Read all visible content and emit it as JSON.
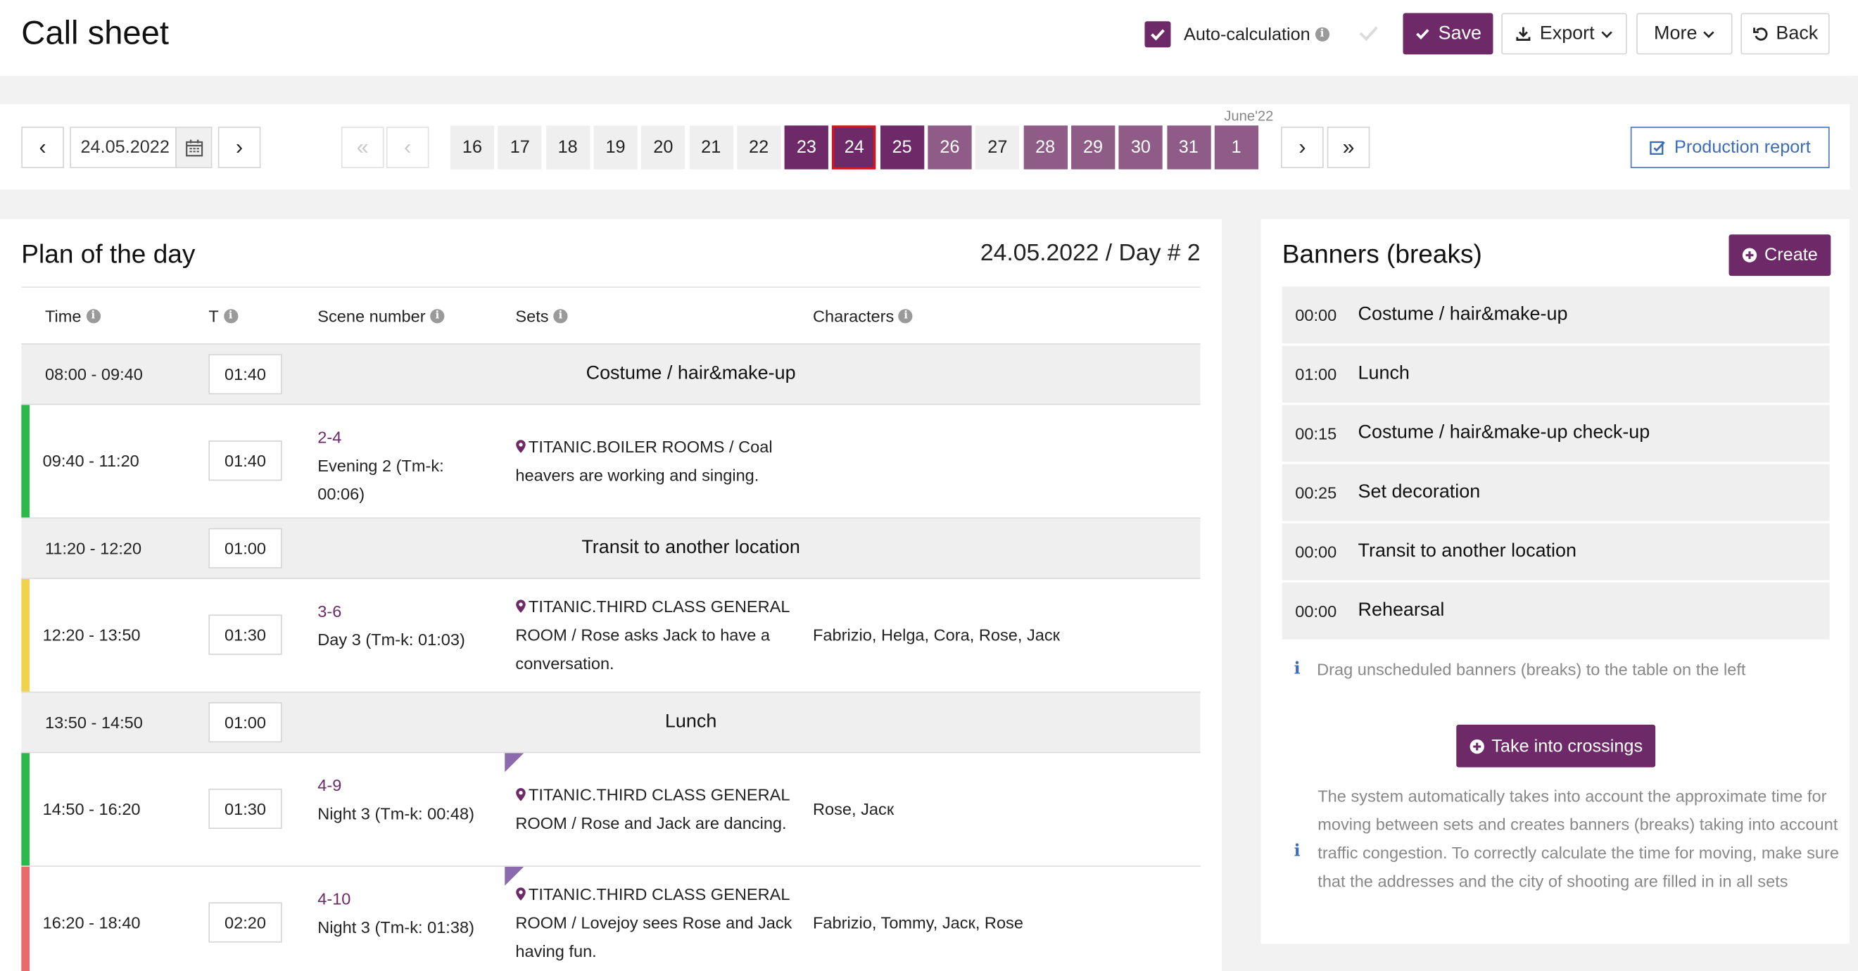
{
  "header": {
    "title": "Call sheet",
    "auto_calc_label": "Auto-calculation",
    "save_label": "Save",
    "export_label": "Export",
    "more_label": "More",
    "back_label": "Back"
  },
  "datebar": {
    "date_value": "24.05.2022",
    "month_label": "June'22",
    "days": [
      {
        "label": "16",
        "state": "plain"
      },
      {
        "label": "17",
        "state": "plain"
      },
      {
        "label": "18",
        "state": "plain"
      },
      {
        "label": "19",
        "state": "plain"
      },
      {
        "label": "20",
        "state": "plain"
      },
      {
        "label": "21",
        "state": "plain"
      },
      {
        "label": "22",
        "state": "plain"
      },
      {
        "label": "23",
        "state": "dark"
      },
      {
        "label": "24",
        "state": "current"
      },
      {
        "label": "25",
        "state": "dark"
      },
      {
        "label": "26",
        "state": "mid"
      },
      {
        "label": "27",
        "state": "plain"
      },
      {
        "label": "28",
        "state": "mid"
      },
      {
        "label": "29",
        "state": "mid"
      },
      {
        "label": "30",
        "state": "mid"
      },
      {
        "label": "31",
        "state": "mid"
      },
      {
        "label": "1",
        "state": "mid"
      }
    ],
    "production_report_label": "Production report"
  },
  "plan": {
    "title": "Plan of the day",
    "date_day": "24.05.2022 / Day # 2",
    "columns": {
      "time": "Time",
      "t": "T",
      "scene_number": "Scene number",
      "sets": "Sets",
      "characters": "Characters"
    },
    "rows": [
      {
        "type": "banner",
        "time": "08:00 - 09:40",
        "duration": "01:40",
        "name": "Costume / hair&make-up"
      },
      {
        "type": "scene",
        "stripe": "#2db84c",
        "time": "09:40 - 11:20",
        "duration": "01:40",
        "scene_num": "2-4",
        "scene_desc": "Evening 2 (Tm-k: 00:06)",
        "set": "TITANIC.BOILER ROOMS / Coal heavers are working and singing.",
        "characters": "",
        "corner": false
      },
      {
        "type": "banner",
        "time": "11:20 - 12:20",
        "duration": "01:00",
        "name": "Transit to another location"
      },
      {
        "type": "scene",
        "stripe": "#f0d24e",
        "time": "12:20 - 13:50",
        "duration": "01:30",
        "scene_num": "3-6",
        "scene_desc": "Day 3 (Tm-k: 01:03)",
        "set": "TITANIC.THIRD CLASS GENERAL ROOM / Rose asks Jack to have a conversation.",
        "characters": "Fabrizio, Helga, Cora, Rose, Jacк",
        "corner": false
      },
      {
        "type": "banner",
        "time": "13:50 - 14:50",
        "duration": "01:00",
        "name": "Lunch"
      },
      {
        "type": "scene",
        "stripe": "#2db84c",
        "time": "14:50 - 16:20",
        "duration": "01:30",
        "scene_num": "4-9",
        "scene_desc": "Night 3 (Tm-k: 00:48)",
        "set": "TITANIC.THIRD CLASS GENERAL ROOM / Rose and Jack are dancing.",
        "characters": "Rose, Jacк",
        "corner": true
      },
      {
        "type": "scene",
        "stripe": "#e86a6a",
        "time": "16:20 - 18:40",
        "duration": "02:20",
        "scene_num": "4-10",
        "scene_desc": "Night 3 (Tm-k: 01:38)",
        "set": "TITANIC.THIRD CLASS GENERAL ROOM / Lovejoy sees Rose and Jack having fun.",
        "characters": "Fabrizio, Tommy, Jacк, Rose",
        "corner": true
      }
    ]
  },
  "banners": {
    "title": "Banners (breaks)",
    "create_label": "Create",
    "items": [
      {
        "duration": "00:00",
        "name": "Costume / hair&make-up"
      },
      {
        "duration": "01:00",
        "name": "Lunch"
      },
      {
        "duration": "00:15",
        "name": "Costume / hair&make-up check-up"
      },
      {
        "duration": "00:25",
        "name": "Set decoration"
      },
      {
        "duration": "00:00",
        "name": "Transit to another location"
      },
      {
        "duration": "00:00",
        "name": "Rehearsal"
      }
    ],
    "hint": "Drag unscheduled banners (breaks) to the table on the left",
    "crossings_label": "Take into crossings",
    "crossings_text": "The system automatically takes into account the approximate time for moving between sets and creates banners (breaks) taking into account traffic congestion. To correctly calculate the time for moving, make sure that the addresses and the city of shooting are filled in in all sets"
  },
  "colors": {
    "accent": "#6e2a68",
    "accent_light": "#8f5c88",
    "current_border": "#d2141e",
    "link_blue": "#3c6cbc"
  }
}
